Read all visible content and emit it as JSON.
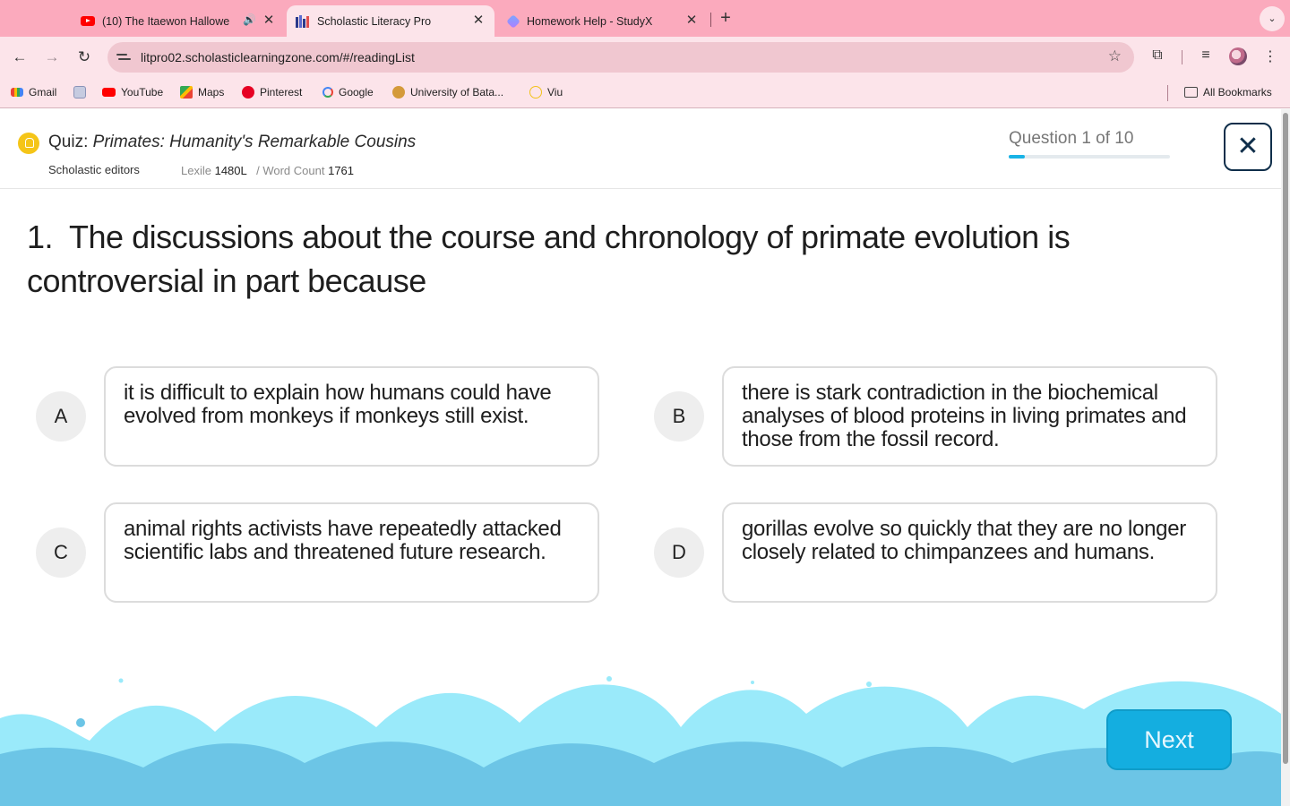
{
  "browser": {
    "tabs": [
      {
        "title": "(10) The Itaewon Hallowe",
        "icon": "youtube-icon",
        "active": false,
        "audio": true
      },
      {
        "title": "Scholastic Literacy Pro",
        "icon": "books-icon",
        "active": true
      },
      {
        "title": "Homework Help - StudyX",
        "icon": "studyx-icon",
        "active": false
      }
    ],
    "url": "litpro02.scholasticlearningzone.com/#/readingList",
    "bookmarks": [
      {
        "label": "Gmail",
        "icon": "gmail-icon"
      },
      {
        "label": "",
        "icon": "news-icon"
      },
      {
        "label": "YouTube",
        "icon": "youtube-icon"
      },
      {
        "label": "Maps",
        "icon": "maps-icon"
      },
      {
        "label": "Pinterest",
        "icon": "pinterest-icon"
      },
      {
        "label": "Google",
        "icon": "google-icon"
      },
      {
        "label": "University of Bata...",
        "icon": "university-icon"
      },
      {
        "label": "Viu",
        "icon": "viu-icon"
      }
    ],
    "all_bookmarks_label": "All Bookmarks"
  },
  "quiz": {
    "title_prefix": "Quiz:",
    "title": "Primates: Humanity's Remarkable Cousins",
    "author": "Scholastic editors",
    "lexile_label": "Lexile",
    "lexile_value": "1480L",
    "word_count_label": "/ Word Count",
    "word_count_value": "1761",
    "question_counter": "Question 1 of 10",
    "progress_fraction": 0.1,
    "question_number": "1.",
    "question_text": "The discussions about the course and chronology of primate evolution is controversial in part because",
    "answers": [
      {
        "letter": "A",
        "text": "it is difficult to explain how humans could have evolved from monkeys if monkeys still exist."
      },
      {
        "letter": "B",
        "text": "there is stark contradiction in the biochemical analyses of blood proteins in living primates and those from the fossil record."
      },
      {
        "letter": "C",
        "text": "animal rights activists have repeatedly attacked scientific labs and threatened future research."
      },
      {
        "letter": "D",
        "text": "gorillas evolve so quickly that they are no longer closely related to chimpanzees and humans."
      }
    ],
    "next_label": "Next"
  },
  "colors": {
    "tabstrip": "#fbaabd",
    "toolbar": "#fce4ea",
    "accent": "#14aee0",
    "wave_light": "#9aeafa",
    "wave_dark": "#6cc5e6"
  }
}
